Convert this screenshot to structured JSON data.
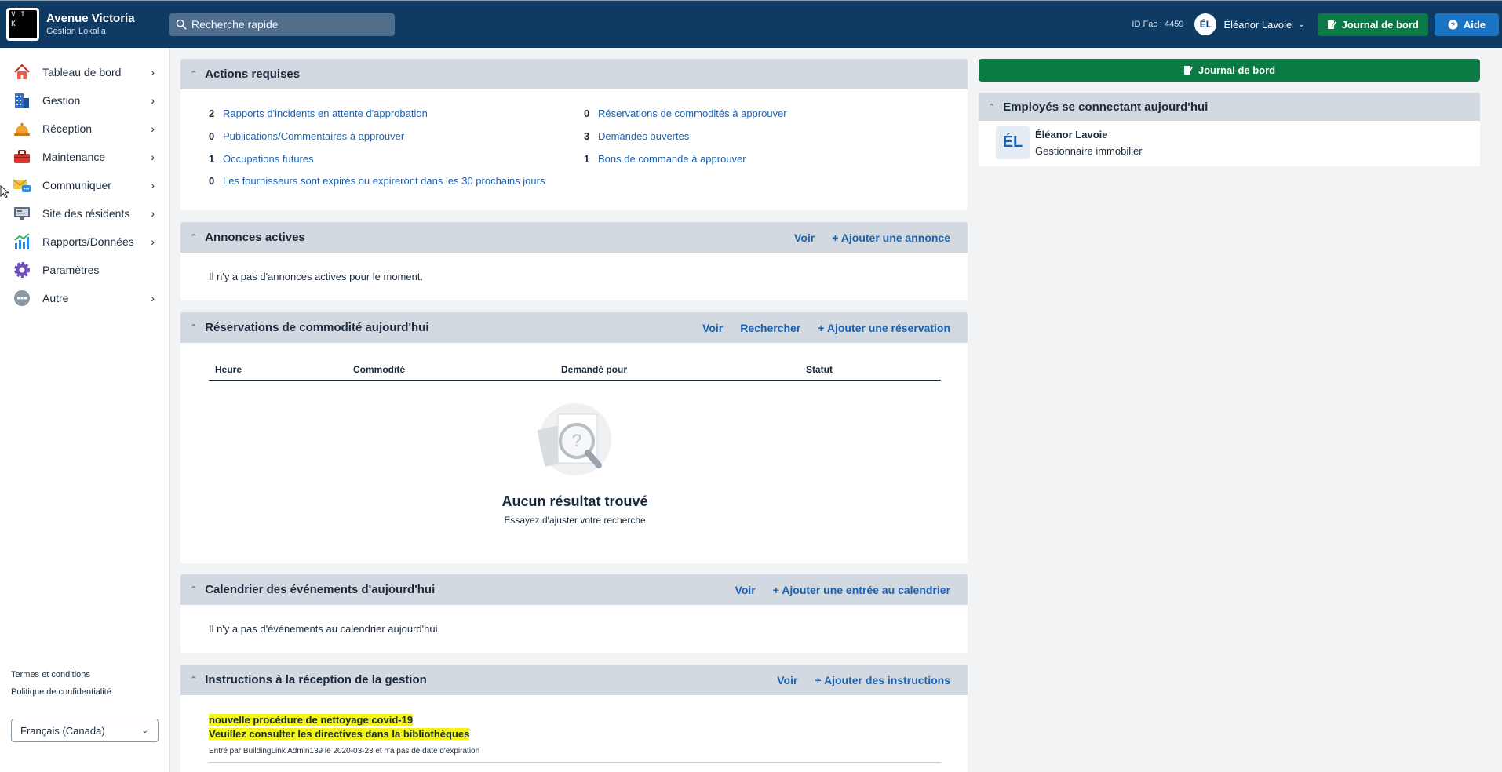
{
  "brand": {
    "logo_letters": [
      "V",
      "I",
      "",
      "K",
      "",
      "",
      "",
      "",
      ""
    ],
    "name": "Avenue Victoria",
    "subtitle": "Gestion Lokalia"
  },
  "search": {
    "placeholder": "Recherche rapide"
  },
  "header": {
    "fac_id": "ID Fac : 4459",
    "user_initials": "ÉL",
    "user_name": "Éléanor Lavoie",
    "journal_label": "Journal de bord",
    "help_label": "Aide"
  },
  "sidebar": {
    "items": [
      {
        "label": "Tableau de bord",
        "icon": "house-icon",
        "has_chevron": true
      },
      {
        "label": "Gestion",
        "icon": "building-icon",
        "has_chevron": true
      },
      {
        "label": "Réception",
        "icon": "bell-icon",
        "has_chevron": true
      },
      {
        "label": "Maintenance",
        "icon": "toolbox-icon",
        "has_chevron": true
      },
      {
        "label": "Communiquer",
        "icon": "envelope-icon",
        "has_chevron": true
      },
      {
        "label": "Site des résidents",
        "icon": "monitor-icon",
        "has_chevron": true
      },
      {
        "label": "Rapports/Données",
        "icon": "chart-icon",
        "has_chevron": true
      },
      {
        "label": "Paramètres",
        "icon": "gear-icon",
        "has_chevron": false
      },
      {
        "label": "Autre",
        "icon": "more-icon",
        "has_chevron": true
      }
    ],
    "terms": "Termes et conditions",
    "privacy": "Politique de confidentialité",
    "language": "Français (Canada)"
  },
  "actions": {
    "title": "Actions requises",
    "left": [
      {
        "count": "2",
        "label": "Rapports d'incidents en attente d'approbation"
      },
      {
        "count": "0",
        "label": "Publications/Commentaires à approuver"
      },
      {
        "count": "1",
        "label": "Occupations futures"
      },
      {
        "count": "0",
        "label": "Les fournisseurs sont expirés ou expireront dans les 30 prochains jours"
      }
    ],
    "right": [
      {
        "count": "0",
        "label": "Réservations de commodités à approuver"
      },
      {
        "count": "3",
        "label": "Demandes ouvertes"
      },
      {
        "count": "1",
        "label": "Bons de commande à approuver"
      }
    ]
  },
  "announcements": {
    "title": "Annonces actives",
    "view": "Voir",
    "add": "+ Ajouter une annonce",
    "empty": "Il n'y a pas d'annonces actives pour le moment."
  },
  "reservations": {
    "title": "Réservations de commodité aujourd'hui",
    "view": "Voir",
    "search": "Rechercher",
    "add": "+ Ajouter une réservation",
    "columns": [
      "Heure",
      "Commodité",
      "Demandé pour",
      "Statut"
    ],
    "empty_title": "Aucun résultat trouvé",
    "empty_sub": "Essayez d'ajuster votre recherche"
  },
  "calendar": {
    "title": "Calendrier des événements d'aujourd'hui",
    "view": "Voir",
    "add": "+ Ajouter une entrée au calendrier",
    "empty": "Il n'y a pas d'événements au calendrier aujourd'hui."
  },
  "instructions": {
    "title": "Instructions à la réception de la gestion",
    "view": "Voir",
    "add": "+ Ajouter des instructions",
    "line1": "nouvelle procédure de nettoyage covid-19",
    "line2": "Veuillez consulter les directives dans la bibliothèques",
    "meta": "Entré par BuildingLink Admin139 le 2020-03-23 et n'a pas de date d'expiration"
  },
  "right": {
    "journal_label": "Journal de bord",
    "employees_title": "Employés se connectant aujourd'hui",
    "employee": {
      "initials": "ÉL",
      "name": "Éléanor Lavoie",
      "role": "Gestionnaire immobilier"
    }
  }
}
